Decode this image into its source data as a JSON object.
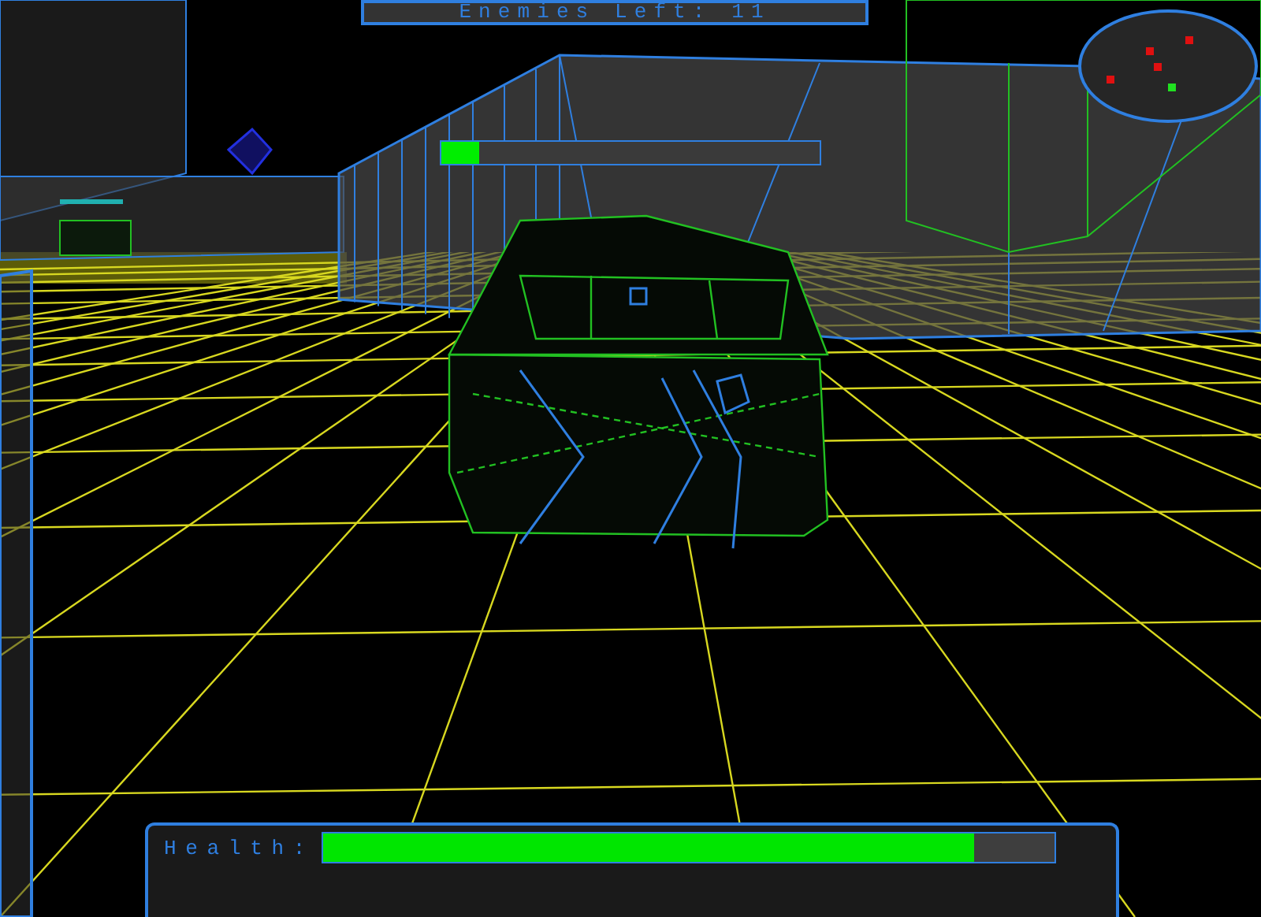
{
  "hud": {
    "enemies_counter": "Enemies Left: 11",
    "target_health": {
      "level": 0.1
    },
    "player_health": {
      "label": "Health:",
      "level": 0.89
    }
  }
}
